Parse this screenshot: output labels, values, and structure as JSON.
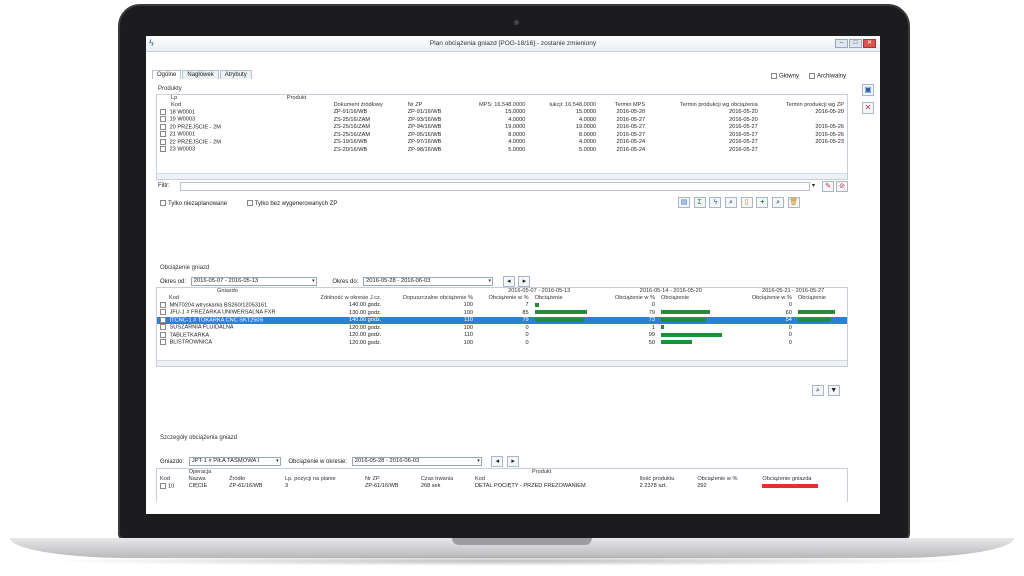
{
  "window": {
    "title": "Plan obciążenia gniazd [POG-18/16] - zostanie zmieniony",
    "minimize": "–",
    "maximize": "□",
    "close": "✕"
  },
  "tabs": [
    {
      "label": "Ogólne"
    },
    {
      "label": "Nagłówek"
    },
    {
      "label": "Atrybuty"
    }
  ],
  "topchecks": {
    "glowny": "Główny",
    "archiwalny": "Archiwalny"
  },
  "produkty": {
    "section": "Produkty",
    "headers": {
      "lp": "Lp",
      "kod": "Kod",
      "produkt": "Produkt",
      "dokument": "Dokument źródłowy",
      "nrzp": "Nr ZP",
      "mps": "MPS: 16,548.0000",
      "lukcji": "łukcji: 16,548.0000",
      "termin_mps": "Termin MPS",
      "termin_obc": "Termin produkcji wg obciążenia",
      "termin_zp": "Termin produkcji wg ZP"
    },
    "rows": [
      {
        "lp": "18",
        "kod": "W0001",
        "produkt": "",
        "dok": "ZP-91/16/WB",
        "nrzp": "ZP-91/16/WB",
        "mps": "15.0000",
        "luk": "15.0000",
        "tmps": "2016-05-20",
        "tobc": "2016-05-20",
        "tzp": "2016-05-20"
      },
      {
        "lp": "19",
        "kod": "W0003",
        "produkt": "",
        "dok": "ZS-25/16/ZAM",
        "nrzp": "ZP-93/16/WB",
        "mps": "4.0000",
        "luk": "4.0000",
        "tmps": "2016-05-27",
        "tobc": "2016-05-20",
        "tzp": ""
      },
      {
        "lp": "20",
        "kod": "PRZEJŚCIE - 2M",
        "produkt": "",
        "dok": "ZS-25/16/ZAM",
        "nrzp": "ZP-94/16/WB",
        "mps": "19.0000",
        "luk": "19.0000",
        "tmps": "2016-05-27",
        "tobc": "2016-05-27",
        "tzp": "2016-05-26"
      },
      {
        "lp": "21",
        "kod": "W0001",
        "produkt": "",
        "dok": "ZS-25/16/ZAM",
        "nrzp": "ZP-95/16/WB",
        "mps": "8.0000",
        "luk": "8.0000",
        "tmps": "2016-05-27",
        "tobc": "2016-05-27",
        "tzp": "2016-05-26"
      },
      {
        "lp": "22",
        "kod": "PRZEJŚCIE - 2M",
        "produkt": "",
        "dok": "ZS-19/16/WB",
        "nrzp": "ZP-97/16/WB",
        "mps": "4.0000",
        "luk": "4.0000",
        "tmps": "2016-05-24",
        "tobc": "2016-05-27",
        "tzp": "2016-05-23"
      },
      {
        "lp": "23",
        "kod": "W0003",
        "produkt": "",
        "dok": "ZS-20/16/WB",
        "nrzp": "ZP-98/16/WB",
        "mps": "5.0000",
        "luk": "5.0000",
        "tmps": "2016-05-24",
        "tobc": "2016-05-27",
        "tzp": ""
      }
    ]
  },
  "filter": {
    "label": "Filtr:",
    "value": ""
  },
  "checks": {
    "niezaplanowane": "Tylko niezaplanowane",
    "bez_zp": "Tylko bez wygenerowanych ZP"
  },
  "obciazenie": {
    "section": "Obciążenie gniazd",
    "okres_od_label": "Okres od:",
    "okres_od_value": "2016-05-07 - 2016-05-13",
    "okres_do_label": "Okres do:",
    "okres_do_value": "2016-05-28 - 2016-06-03",
    "headers": {
      "gniazdo": "Gniazdo",
      "kod": "Kod",
      "zdolnosc": "Zdolność w okresie J.cz.",
      "dopuszczalne": "Dopuszczalne obciążenie %",
      "p1": "2016-05-07 - 2016-05-13",
      "p2": "2016-05-14 - 2016-05-20",
      "p3": "2016-05-21 - 2016-05-27",
      "obc_pct": "Obciążenie w %",
      "obc": "Obciążenie"
    },
    "rows": [
      {
        "kod": "MNT0204 wtryskarka BS260/12053161",
        "zd": "140.00 godz.",
        "dop": "100",
        "p1": 7,
        "p2": 0,
        "p3": 0,
        "sel": false
      },
      {
        "kod": "JFU-1 # FREZARKA UNIWERSALNA FXR",
        "zd": "130.00 godz.",
        "dop": "100",
        "p1": 85,
        "p2": 79,
        "p3": 60,
        "sel": false
      },
      {
        "kod": "ITCNC-1 # TOKARKA CNC SKT250S",
        "zd": "140.00 godz.",
        "dop": "110",
        "p1": 79,
        "p2": 73,
        "p3": 54,
        "sel": true
      },
      {
        "kod": "SUSZARNIA FLUIDALNA",
        "zd": "120.00 godz.",
        "dop": "100",
        "p1": 0,
        "p2": 1,
        "p3": 0,
        "sel": false
      },
      {
        "kod": "TABLETKARKA",
        "zd": "120.00 godz.",
        "dop": "110",
        "p1": 0,
        "p2": 99,
        "p3": 0,
        "sel": false
      },
      {
        "kod": "BLISTROWNICA",
        "zd": "120.00 godz.",
        "dop": "100",
        "p1": 0,
        "p2": 50,
        "p3": 0,
        "sel": false
      }
    ]
  },
  "szczegoly": {
    "section": "Szczegóły obciążenia gniazd",
    "gniazdo_label": "Gniazdo:",
    "gniazdo_value": "JPT-1 # PIŁA TAŚMOWA I",
    "okres_label": "Obciążenie w okresie:",
    "okres_value": "2016-05-28 - 2016-06-03",
    "headers": {
      "operacja": "Operacja",
      "kod": "Kod",
      "nazwa": "Nazwa",
      "zrodlo": "Źródło",
      "lp": "Lp. pozycji na planie",
      "nrzp": "Nr ZP",
      "czas": "Czas trwania",
      "produkt": "Produkt",
      "pkod": "Kod",
      "ilosc": "Ilość produktu",
      "obc_pct": "Obciążenie w %",
      "obc_gn": "Obciążenie gniazda"
    },
    "row": {
      "kod": "10",
      "nazwa": "CIĘCIE",
      "zrodlo": "ZP-61/16/WB",
      "lp": "3",
      "nrzp": "ZP-61/16/WB",
      "czas": "268 sek",
      "pkod": "DETAL POCIĘTY - PRZED FREZOWANIEM",
      "ilosc": "2.2378 szt.",
      "obc": "292"
    }
  }
}
